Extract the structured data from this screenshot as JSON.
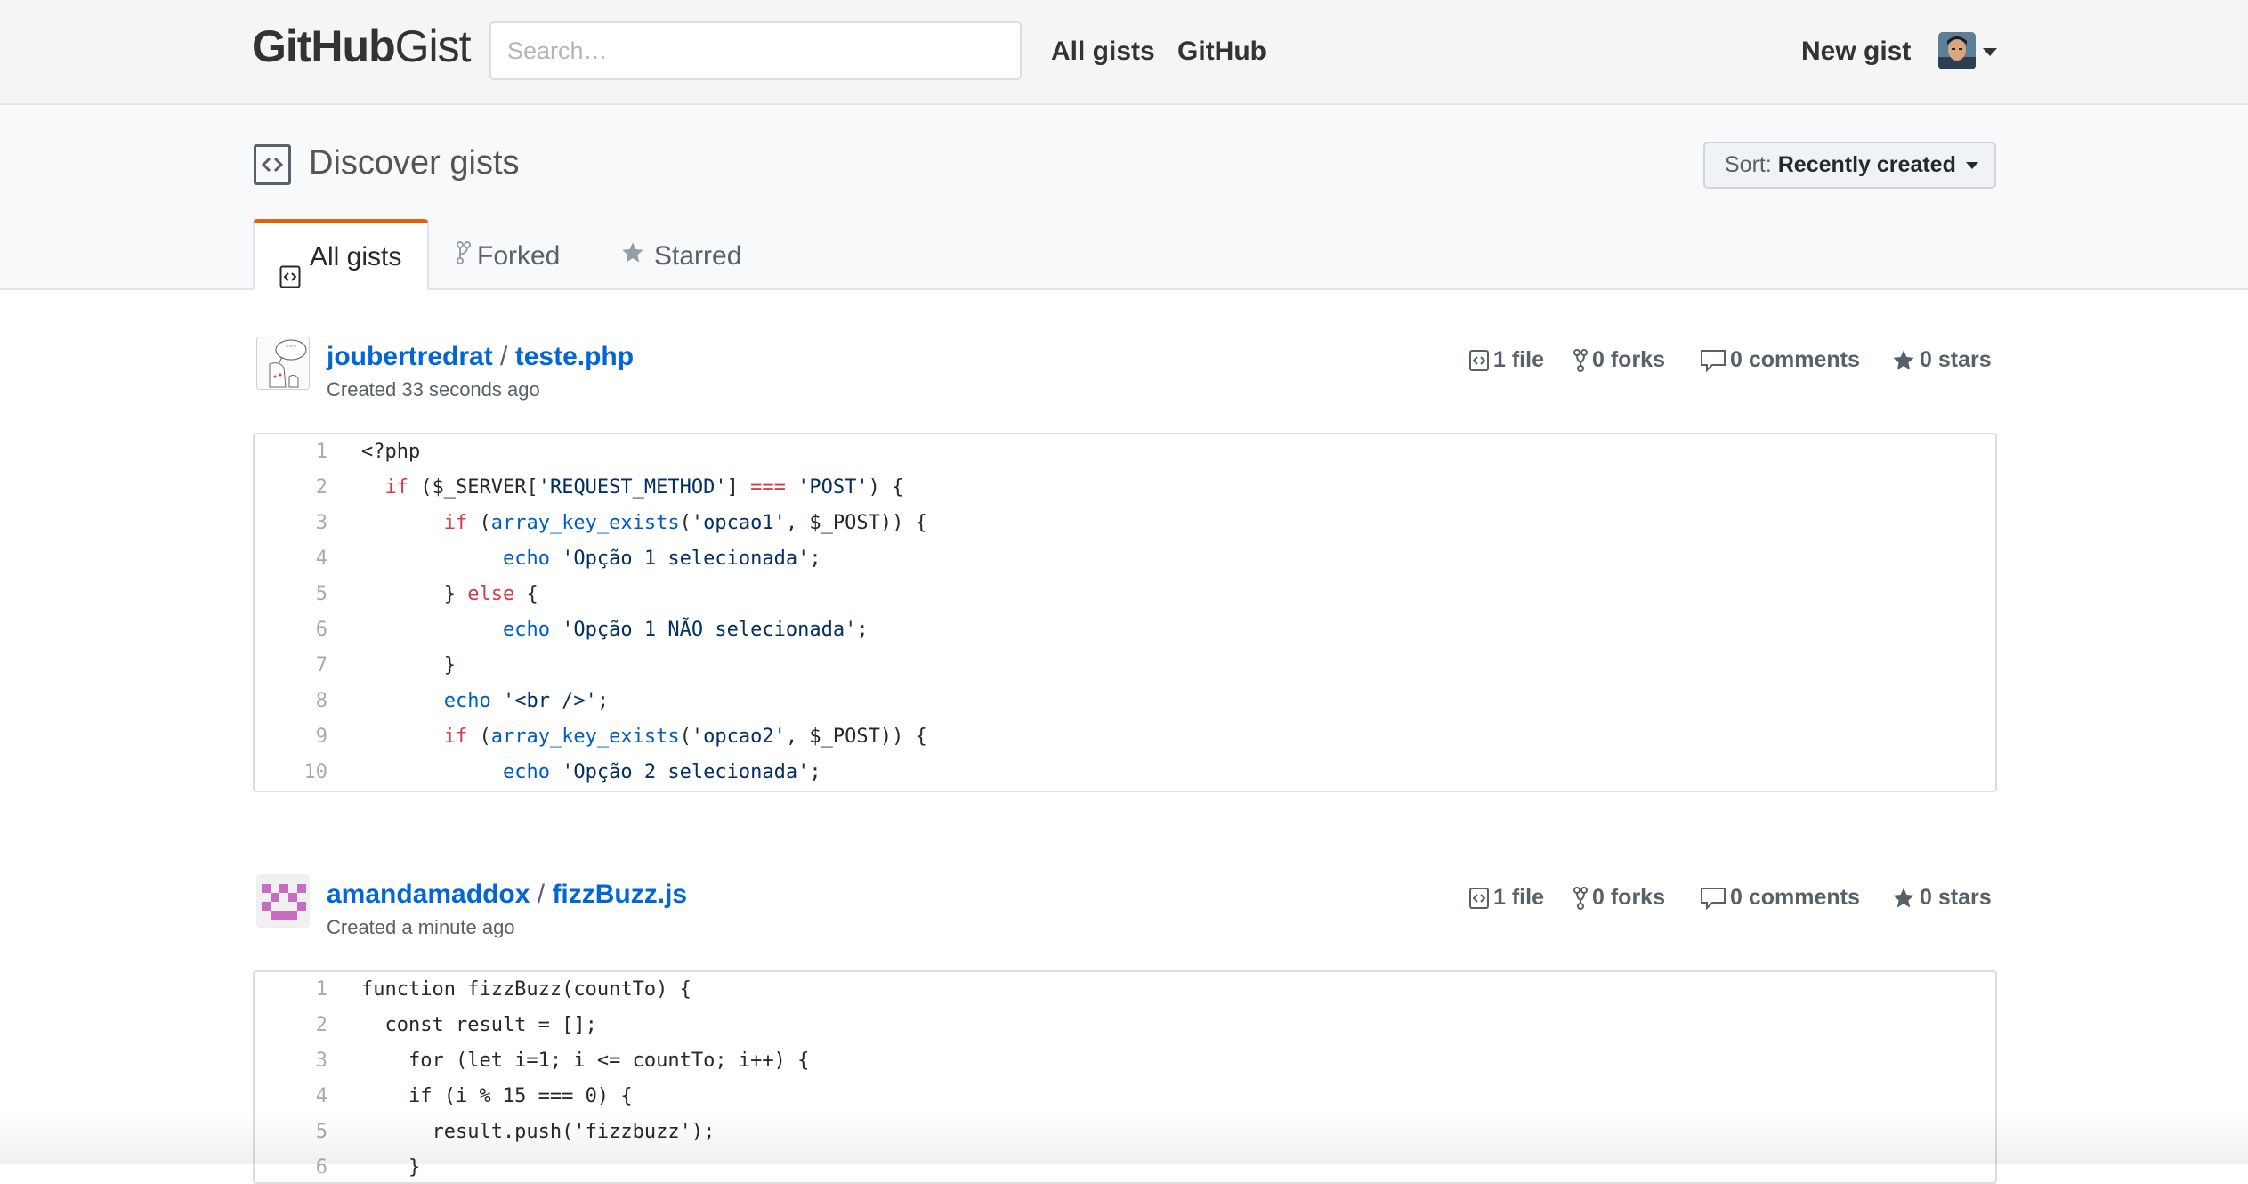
{
  "header": {
    "logo_github": "GitHub",
    "logo_gist": "Gist",
    "search_placeholder": "Search…",
    "nav": [
      "All gists",
      "GitHub"
    ],
    "new_gist": "New gist"
  },
  "pagehead": {
    "title": "Discover gists",
    "sort_label": "Sort:",
    "sort_value": "Recently created"
  },
  "tabs": {
    "all": "All gists",
    "forked": "Forked",
    "starred": "Starred"
  },
  "gists": [
    {
      "user": "joubertredrat",
      "separator": "/",
      "filename": "teste.php",
      "created": "Created 33 seconds ago",
      "files": "1 file",
      "forks": "0 forks",
      "comments": "0 comments",
      "stars": "0 stars",
      "lines": [
        {
          "n": "1",
          "code": "<?php"
        },
        {
          "n": "2",
          "code": "  if ($_SERVER['REQUEST_METHOD'] === 'POST') {"
        },
        {
          "n": "3",
          "code": "       if (array_key_exists('opcao1', $_POST)) {"
        },
        {
          "n": "4",
          "code": "            echo 'Opção 1 selecionada';"
        },
        {
          "n": "5",
          "code": "       } else {"
        },
        {
          "n": "6",
          "code": "            echo 'Opção 1 NÃO selecionada';"
        },
        {
          "n": "7",
          "code": "       }"
        },
        {
          "n": "8",
          "code": "       echo '<br />';"
        },
        {
          "n": "9",
          "code": "       if (array_key_exists('opcao2', $_POST)) {"
        },
        {
          "n": "10",
          "code": "            echo 'Opção 2 selecionada';"
        }
      ]
    },
    {
      "user": "amandamaddox",
      "separator": "/",
      "filename": "fizzBuzz.js",
      "created": "Created a minute ago",
      "files": "1 file",
      "forks": "0 forks",
      "comments": "0 comments",
      "stars": "0 stars",
      "lines": [
        {
          "n": "1",
          "code": "function fizzBuzz(countTo) {"
        },
        {
          "n": "2",
          "code": "  const result = [];"
        },
        {
          "n": "3",
          "code": "    for (let i=1; i <= countTo; i++) {"
        },
        {
          "n": "4",
          "code": "    if (i % 15 === 0) {"
        },
        {
          "n": "5",
          "code": "      result.push('fizzbuzz');"
        },
        {
          "n": "6",
          "code": "    }"
        }
      ]
    }
  ],
  "colors": {
    "link": "#0366d6",
    "tab_accent": "#e36209",
    "keyword": "#d73a49",
    "function": "#005cc5"
  }
}
